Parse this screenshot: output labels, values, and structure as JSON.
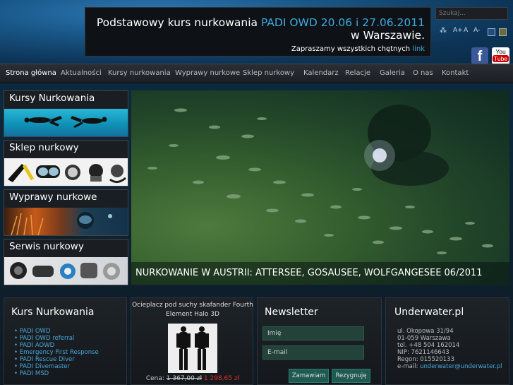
{
  "announcement": {
    "prefix": "Podstawowy kurs nurkowania",
    "highlight": "PADI OWD 20.06 i 27.06.2011",
    "suffix": "w Warszawie.",
    "invite_text": "Zapraszamy wszystkich chętnych",
    "invite_link": "link"
  },
  "search": {
    "placeholder": "Szukaj..."
  },
  "tools": {
    "font_icons": [
      "A+",
      "A",
      "A-"
    ],
    "theme_colors": [
      "#1a4d8c",
      "#6b6b3a"
    ]
  },
  "social": {
    "facebook": "f",
    "youtube_you": "You",
    "youtube_tube": "Tube"
  },
  "nav": {
    "items": [
      "Strona główna",
      "Aktualności",
      "Kursy nurkowania",
      "Wyprawy nurkowe",
      "Sklep nurkowy",
      "Kalendarz",
      "Relacje",
      "Galeria",
      "O nas",
      "Kontakt"
    ]
  },
  "sidebar": {
    "items": [
      {
        "title": "Kursy Nurkowania"
      },
      {
        "title": "Sklep nurkowy"
      },
      {
        "title": "Wyprawy nurkowe"
      },
      {
        "title": "Serwis nurkowy"
      }
    ]
  },
  "hero": {
    "caption": "NURKOWANIE W AUSTRII: ATTERSEE, GOSAUSEE, WOLFGANGESEE 06/2011"
  },
  "kurs": {
    "title": "Kurs Nurkowania",
    "items": [
      "PADI OWD",
      "PADI OWD referral",
      "PADI AOWD",
      "Emergency First Response",
      "PADI Rescue Diver",
      "PADI Divemaster",
      "PADI MSD"
    ]
  },
  "product": {
    "title_line1": "Ocieplacz pod suchy skafander Fourth",
    "title_line2": "Element Halo 3D",
    "price_label": "Cena:",
    "old_price": "1 367,00 zł",
    "new_price": "1 298,65 zł"
  },
  "newsletter": {
    "title": "Newsletter",
    "name_placeholder": "Imię",
    "email_placeholder": "E-mail",
    "subscribe": "Zamawiam",
    "unsubscribe": "Rezygnuję"
  },
  "contact": {
    "title": "Underwater.pl",
    "street": "ul. Okopowa 31/94",
    "city": "01-059 Warszawa",
    "phone": "tel. +48 504 162014",
    "nip": "NIP: 7621146643",
    "regon": "Regon: 015520133",
    "email_label": "e-mail:",
    "email": "underwater@underwater.pl"
  }
}
